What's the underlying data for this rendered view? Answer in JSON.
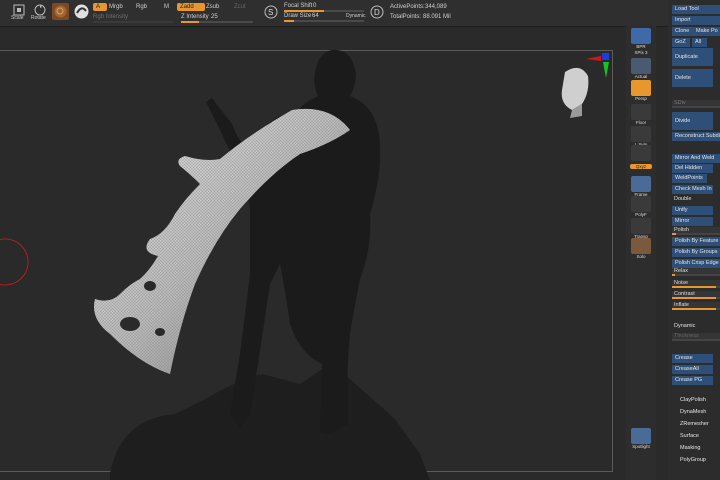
{
  "toolbar": {
    "scale_label": "Scale",
    "rotate_label": "Rotate",
    "a_label": "A",
    "mrgb_label": "Mrgb",
    "rgb_label": "Rgb",
    "m_label": "M",
    "zadd_label": "Zadd",
    "zsub_label": "Zsub",
    "zcut_label": "Zcut",
    "rgb_intensity_label": "Rgb Intensity",
    "z_intensity_label": "Z Intensity",
    "z_intensity_value": "25",
    "focal_shift_label": "Focal Shift",
    "focal_shift_value": "0",
    "draw_size_label": "Draw Size",
    "draw_size_value": "64",
    "dynamic_label": "Dynamic",
    "active_points_label": "ActivePoints:",
    "active_points_value": "344,089",
    "total_points_label": "TotalPoints:",
    "total_points_value": "88.091 Mil",
    "z_intensity_fraction": 0.25,
    "focal_shift_fraction": 0.5,
    "draw_size_fraction": 0.12
  },
  "right_shelf": {
    "bpr_label": "BPR",
    "spix_label": "SPix",
    "spix_value": "3",
    "actual_label": "Actual",
    "persp_label": "Persp",
    "floor_label": "Floor",
    "lsym_label": "L.Sym",
    "xyz_label": "Qxyz",
    "frame_label": "Frame",
    "polyf_label": "PolyF",
    "transp_label": "Transp",
    "solo_label": "Solo",
    "spotlight_label": "Spotlight",
    "colors": {
      "active": "#e8962e"
    }
  },
  "tool_panel": {
    "load_tool": "Load Tool",
    "import": "Import",
    "clone": "Clone",
    "make_poly": "Make Po",
    "goz": "GoZ",
    "all": "All",
    "duplicate": "Duplicate",
    "delete": "Delete",
    "sdiv_label": "SDiv",
    "divide": "Divide",
    "reconstruct_subdiv": "Reconstruct Subdi",
    "mirror_and_weld": "Mirror And Weld",
    "del_hidden": "Del Hidden",
    "weldpoints": "WeldPoints",
    "check_mesh_int": "Check Mesh In",
    "double": "Double",
    "unify": "Unify",
    "mirror": "Mirror",
    "polish": "Polish",
    "polish_by_features": "Polish By Feature",
    "polish_by_groups": "Polish By Groups",
    "polish_crisp_edges": "Polish Crisp Edge",
    "relax": "Relax",
    "noise": "Noise",
    "contrast": "Contrast",
    "inflate": "Inflate",
    "dynamic": "Dynamic",
    "thickness": "Thickness",
    "crease": "Crease",
    "creaseall": "CreaseAll",
    "crease_pg": "Crease PG",
    "claypolish": "ClayPolish",
    "dynamesh": "DynaMesh",
    "zremesher": "ZRemesher",
    "surface": "Surface",
    "masking": "Masking",
    "polygroup": "PolyGroup"
  }
}
